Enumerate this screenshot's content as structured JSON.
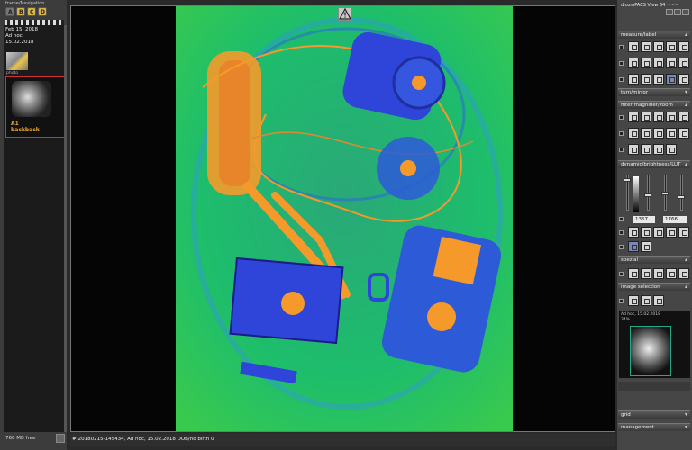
{
  "left": {
    "title": "frame/Navigation",
    "buttons": [
      "A",
      "B",
      "C",
      "D"
    ],
    "study_info": [
      "Feb 15, 2018",
      "Ad hoc",
      "15.02.2018"
    ],
    "photo_label": "photo",
    "series_label": [
      "A1",
      "backback"
    ],
    "memory": "768 MB free"
  },
  "app": {
    "title": "dicomPACS View 64 ~~~"
  },
  "right": {
    "sections": {
      "measure": "measure/label",
      "turn": "turn/mirror",
      "filter": "filter/magnifier/zoom",
      "dynamic": "dynamic/brightness/LUT",
      "spezial": "spezial",
      "image_selection": "image selection",
      "grid": "grid",
      "management": "management"
    },
    "window_values": [
      "1367",
      "1766"
    ],
    "mini_info": [
      "Ad hoc, 15.02.2018",
      "34%"
    ]
  },
  "status": {
    "text": "#-20180215-145434, Ad hoc, 15.02.2018 DOB/no birth 0"
  },
  "viewer": {
    "warning_icon": "warning-icon",
    "colors": {
      "background": "#1bbe72",
      "metal": "#f59a2a",
      "organic": "#2d5bd8"
    }
  }
}
